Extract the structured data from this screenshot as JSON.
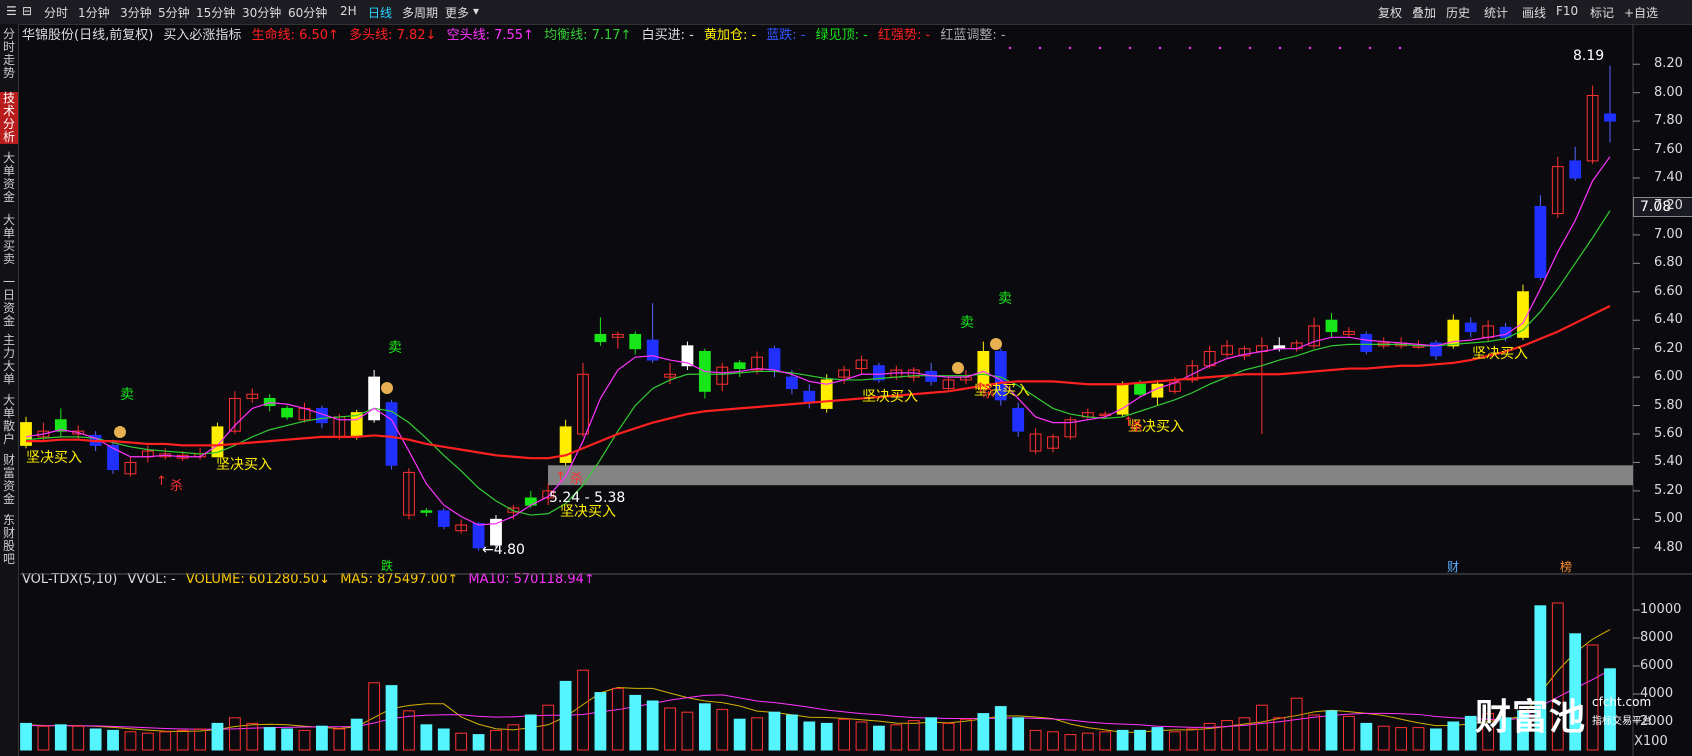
{
  "topbar": {
    "tabs": [
      "分时",
      "1分钟",
      "3分钟",
      "5分钟",
      "15分钟",
      "30分钟",
      "60分钟",
      "2H",
      "日线",
      "多周期",
      "更多"
    ],
    "active": "日线",
    "right_tabs": [
      "复权",
      "叠加",
      "历史",
      "统计",
      "画线",
      "F10",
      "标记",
      "+自选"
    ]
  },
  "sidebar": [
    "分时走势",
    "技术分析",
    "大单资金",
    "大单买卖",
    "一日资金",
    "主力大单",
    "大单散户",
    "财富资金",
    "东财股吧"
  ],
  "legend": {
    "stock": "华锦股份(日线,前复权)",
    "indicator": "买入必涨指标",
    "life_line": "生命线: 6.50↑",
    "bull_line": "多头线: 7.82↓",
    "bear_line": "空头线: 7.55↑",
    "balance_line": "均衡线: 7.17↑",
    "white_buy": "白买进: -",
    "yellow_add": "黄加仓: -",
    "blue_fall": "蓝跌: -",
    "green_top": "绿见顶: -",
    "red_strong": "红强势: -",
    "red_blue_adjust": "红蓝调整: -"
  },
  "price_axis": [
    "8.20",
    "8.00",
    "7.80",
    "7.60",
    "7.40",
    "7.20",
    "7.00",
    "6.80",
    "6.60",
    "6.40",
    "6.20",
    "6.00",
    "5.80",
    "5.60",
    "5.40",
    "5.20",
    "5.00",
    "4.80"
  ],
  "current_price": "7.08",
  "annotations": {
    "high": "8.19",
    "low": "4.80",
    "zone": "5.24 - 5.38",
    "firm_buy": "坚决买入",
    "sell": "卖",
    "kill": "杀",
    "fall": "跌",
    "fin": "财",
    "rank": "榜"
  },
  "volume_legend": {
    "name": "VOL-TDX(5,10)",
    "vvol": "VVOL: -",
    "volume": "VOLUME: 601280.50↓",
    "ma5": "MA5: 875497.00↑",
    "ma10": "MA10: 570118.94↑"
  },
  "volume_axis": [
    "10000",
    "8000",
    "6000",
    "4000",
    "2000"
  ],
  "volume_unit": "X100",
  "watermark": {
    "brand": "财富池",
    "site": "cfcht.com",
    "slogan": "指标交易平台"
  },
  "colors": {
    "up": "#ff3030",
    "down_blue": "#2030ff",
    "yellow": "#ffee00",
    "green": "#19e619",
    "white": "#ffffff",
    "life": "#ff2020",
    "magenta": "#ff33ff",
    "balance": "#33cc33",
    "vol_cyan": "#55f5ff"
  },
  "chart_data": {
    "type": "candlestick",
    "ylim": [
      4.7,
      8.3
    ],
    "candles": [
      [
        5.68,
        5.52,
        5.72,
        5.5,
        "yellow"
      ],
      [
        5.58,
        5.62,
        5.68,
        5.55,
        "up"
      ],
      [
        5.62,
        5.7,
        5.78,
        5.58,
        "green"
      ],
      [
        5.62,
        5.6,
        5.66,
        5.56,
        "up"
      ],
      [
        5.59,
        5.52,
        5.62,
        5.48,
        "blue"
      ],
      [
        5.52,
        5.35,
        5.56,
        5.32,
        "blue"
      ],
      [
        5.4,
        5.32,
        5.44,
        5.3,
        "up"
      ],
      [
        5.44,
        5.48,
        5.52,
        5.4,
        "up"
      ],
      [
        5.46,
        5.44,
        5.5,
        5.42,
        "up"
      ],
      [
        5.45,
        5.43,
        5.48,
        5.41,
        "up"
      ],
      [
        5.44,
        5.46,
        5.5,
        5.42,
        "up"
      ],
      [
        5.44,
        5.65,
        5.68,
        5.44,
        "yellow"
      ],
      [
        5.62,
        5.85,
        5.9,
        5.6,
        "up"
      ],
      [
        5.85,
        5.88,
        5.92,
        5.82,
        "up"
      ],
      [
        5.85,
        5.8,
        5.88,
        5.76,
        "green"
      ],
      [
        5.78,
        5.72,
        5.8,
        5.7,
        "green"
      ],
      [
        5.7,
        5.78,
        5.82,
        5.68,
        "up"
      ],
      [
        5.78,
        5.68,
        5.8,
        5.64,
        "blue"
      ],
      [
        5.72,
        5.58,
        5.74,
        5.56,
        "up"
      ],
      [
        5.58,
        5.75,
        5.77,
        5.56,
        "yellow"
      ],
      [
        5.7,
        6.0,
        6.05,
        5.68,
        "white"
      ],
      [
        5.82,
        5.38,
        5.84,
        5.35,
        "blue"
      ],
      [
        5.33,
        5.03,
        5.36,
        5.0,
        "up"
      ],
      [
        5.05,
        5.06,
        5.08,
        5.02,
        "green"
      ],
      [
        5.06,
        4.95,
        5.08,
        4.93,
        "blue"
      ],
      [
        4.96,
        4.92,
        5.0,
        4.9,
        "up"
      ],
      [
        4.97,
        4.8,
        4.98,
        4.78,
        "blue"
      ],
      [
        4.82,
        5.0,
        5.03,
        4.8,
        "white"
      ],
      [
        5.05,
        5.08,
        5.1,
        5.0,
        "up"
      ],
      [
        5.1,
        5.15,
        5.2,
        5.08,
        "green"
      ],
      [
        5.15,
        5.2,
        5.25,
        5.1,
        "up"
      ],
      [
        5.4,
        5.65,
        5.7,
        5.38,
        "yellow"
      ],
      [
        5.6,
        6.02,
        6.1,
        5.58,
        "up"
      ],
      [
        6.25,
        6.3,
        6.42,
        6.22,
        "green"
      ],
      [
        6.3,
        6.28,
        6.32,
        6.2,
        "up"
      ],
      [
        6.3,
        6.2,
        6.32,
        6.16,
        "green"
      ],
      [
        6.26,
        6.12,
        6.52,
        6.1,
        "blue"
      ],
      [
        6.02,
        6.0,
        6.1,
        5.95,
        "up"
      ],
      [
        6.22,
        6.08,
        6.25,
        6.05,
        "white"
      ],
      [
        6.18,
        5.9,
        6.2,
        5.85,
        "green"
      ],
      [
        5.95,
        6.07,
        6.1,
        5.9,
        "up"
      ],
      [
        6.06,
        6.1,
        6.12,
        6.0,
        "green"
      ],
      [
        6.05,
        6.14,
        6.18,
        6.02,
        "up"
      ],
      [
        6.2,
        6.05,
        6.22,
        6.0,
        "blue"
      ],
      [
        6.0,
        5.92,
        6.05,
        5.88,
        "blue"
      ],
      [
        5.9,
        5.82,
        5.95,
        5.78,
        "blue"
      ],
      [
        5.78,
        5.98,
        6.02,
        5.75,
        "yellow"
      ],
      [
        6.0,
        6.05,
        6.08,
        5.95,
        "up"
      ],
      [
        6.06,
        6.12,
        6.15,
        6.02,
        "up"
      ],
      [
        6.08,
        5.98,
        6.1,
        5.96,
        "blue"
      ],
      [
        6.0,
        6.05,
        6.08,
        5.98,
        "up"
      ],
      [
        6.0,
        6.05,
        6.07,
        5.97,
        "up"
      ],
      [
        6.04,
        5.97,
        6.1,
        5.94,
        "blue"
      ],
      [
        5.92,
        5.98,
        6.0,
        5.9,
        "up"
      ],
      [
        5.98,
        6.0,
        6.05,
        5.95,
        "up"
      ],
      [
        5.92,
        6.18,
        6.25,
        5.9,
        "yellow"
      ],
      [
        6.18,
        5.84,
        6.2,
        5.8,
        "blue"
      ],
      [
        5.78,
        5.62,
        5.82,
        5.58,
        "blue"
      ],
      [
        5.6,
        5.48,
        5.64,
        5.46,
        "up"
      ],
      [
        5.5,
        5.58,
        5.6,
        5.47,
        "up"
      ],
      [
        5.58,
        5.7,
        5.72,
        5.56,
        "up"
      ],
      [
        5.72,
        5.75,
        5.78,
        5.7,
        "up"
      ],
      [
        5.74,
        5.74,
        5.76,
        5.72,
        "up"
      ],
      [
        5.74,
        5.95,
        5.97,
        5.72,
        "yellow"
      ],
      [
        5.95,
        5.88,
        5.98,
        5.86,
        "green"
      ],
      [
        5.86,
        5.95,
        5.98,
        5.8,
        "yellow"
      ],
      [
        5.9,
        5.96,
        6.0,
        5.88,
        "up"
      ],
      [
        5.98,
        6.08,
        6.12,
        5.96,
        "up"
      ],
      [
        6.08,
        6.18,
        6.22,
        6.06,
        "up"
      ],
      [
        6.16,
        6.22,
        6.26,
        6.14,
        "up"
      ],
      [
        6.2,
        6.15,
        6.22,
        6.12,
        "up"
      ],
      [
        6.18,
        6.22,
        6.28,
        5.6,
        "up"
      ],
      [
        6.2,
        6.22,
        6.28,
        6.18,
        "white"
      ],
      [
        6.24,
        6.2,
        6.26,
        6.18,
        "up"
      ],
      [
        6.22,
        6.36,
        6.42,
        6.2,
        "up"
      ],
      [
        6.4,
        6.32,
        6.45,
        6.28,
        "green"
      ],
      [
        6.3,
        6.32,
        6.35,
        6.28,
        "up"
      ],
      [
        6.3,
        6.18,
        6.32,
        6.16,
        "blue"
      ],
      [
        6.22,
        6.24,
        6.28,
        6.2,
        "up"
      ],
      [
        6.24,
        6.22,
        6.28,
        6.2,
        "up"
      ],
      [
        6.22,
        6.22,
        6.26,
        6.2,
        "up"
      ],
      [
        6.24,
        6.15,
        6.26,
        6.12,
        "blue"
      ],
      [
        6.22,
        6.4,
        6.44,
        6.2,
        "yellow"
      ],
      [
        6.38,
        6.32,
        6.42,
        6.28,
        "blue"
      ],
      [
        6.28,
        6.36,
        6.4,
        6.25,
        "up"
      ],
      [
        6.35,
        6.28,
        6.38,
        6.25,
        "blue"
      ],
      [
        6.28,
        6.6,
        6.65,
        6.26,
        "yellow"
      ],
      [
        6.7,
        7.2,
        7.28,
        6.68,
        "blue"
      ],
      [
        7.15,
        7.48,
        7.55,
        7.12,
        "up"
      ],
      [
        7.52,
        7.4,
        7.62,
        7.38,
        "blue"
      ],
      [
        7.52,
        7.98,
        8.05,
        7.5,
        "up"
      ],
      [
        7.85,
        7.8,
        8.19,
        7.65,
        "blue"
      ]
    ],
    "life_line": [
      5.55,
      5.55,
      5.56,
      5.56,
      5.55,
      5.55,
      5.54,
      5.53,
      5.53,
      5.52,
      5.52,
      5.52,
      5.53,
      5.54,
      5.55,
      5.56,
      5.57,
      5.58,
      5.58,
      5.58,
      5.59,
      5.58,
      5.56,
      5.53,
      5.51,
      5.49,
      5.47,
      5.45,
      5.44,
      5.43,
      5.43,
      5.45,
      5.5,
      5.55,
      5.6,
      5.64,
      5.68,
      5.71,
      5.74,
      5.76,
      5.77,
      5.78,
      5.79,
      5.8,
      5.81,
      5.82,
      5.83,
      5.84,
      5.85,
      5.86,
      5.87,
      5.88,
      5.89,
      5.9,
      5.92,
      5.94,
      5.96,
      5.97,
      5.97,
      5.97,
      5.96,
      5.95,
      5.95,
      5.95,
      5.96,
      5.97,
      5.98,
      5.99,
      6.0,
      6.01,
      6.02,
      6.02,
      6.02,
      6.03,
      6.04,
      6.05,
      6.06,
      6.06,
      6.07,
      6.08,
      6.08,
      6.09,
      6.1,
      6.12,
      6.15,
      6.18,
      6.22,
      6.27,
      6.32,
      6.38,
      6.44,
      6.5
    ],
    "magenta_line": [
      5.58,
      5.6,
      5.63,
      5.61,
      5.57,
      5.5,
      5.44,
      5.44,
      5.45,
      5.44,
      5.44,
      5.52,
      5.66,
      5.78,
      5.82,
      5.81,
      5.78,
      5.74,
      5.7,
      5.7,
      5.78,
      5.7,
      5.48,
      5.25,
      5.1,
      5.02,
      4.96,
      4.97,
      5.02,
      5.1,
      5.16,
      5.3,
      5.55,
      5.85,
      6.05,
      6.14,
      6.15,
      6.12,
      6.1,
      6.04,
      6.03,
      6.04,
      6.06,
      6.05,
      6.02,
      5.97,
      5.95,
      5.98,
      6.02,
      6.02,
      6.03,
      6.03,
      6.01,
      6.0,
      6.0,
      6.04,
      5.98,
      5.85,
      5.72,
      5.68,
      5.68,
      5.7,
      5.72,
      5.78,
      5.86,
      5.92,
      5.96,
      6.02,
      6.08,
      6.13,
      6.16,
      6.18,
      6.2,
      6.2,
      6.25,
      6.28,
      6.28,
      6.26,
      6.25,
      6.24,
      6.23,
      6.22,
      6.25,
      6.26,
      6.28,
      6.3,
      6.38,
      6.62,
      6.88,
      7.1,
      7.38,
      7.55
    ],
    "green_line": [
      5.56,
      5.57,
      5.58,
      5.58,
      5.57,
      5.54,
      5.51,
      5.49,
      5.48,
      5.47,
      5.46,
      5.47,
      5.52,
      5.58,
      5.63,
      5.66,
      5.69,
      5.71,
      5.72,
      5.73,
      5.78,
      5.76,
      5.68,
      5.57,
      5.45,
      5.34,
      5.22,
      5.13,
      5.06,
      5.03,
      5.04,
      5.11,
      5.24,
      5.42,
      5.62,
      5.8,
      5.92,
      5.98,
      6.02,
      6.02,
      6.02,
      6.03,
      6.04,
      6.04,
      6.03,
      6.01,
      5.99,
      5.98,
      5.98,
      5.99,
      6.0,
      6.01,
      6.01,
      6.01,
      6.01,
      6.02,
      6.0,
      5.94,
      5.86,
      5.78,
      5.74,
      5.72,
      5.71,
      5.72,
      5.76,
      5.8,
      5.84,
      5.89,
      5.95,
      6.0,
      6.05,
      6.08,
      6.12,
      6.15,
      6.19,
      6.22,
      6.23,
      6.23,
      6.23,
      6.23,
      6.22,
      6.22,
      6.23,
      6.24,
      6.25,
      6.27,
      6.33,
      6.46,
      6.62,
      6.8,
      6.98,
      7.17
    ],
    "zone": [
      5.24,
      5.38
    ],
    "volumes": [
      1900,
      1700,
      1800,
      1700,
      1500,
      1400,
      1300,
      1200,
      1300,
      1400,
      1500,
      1900,
      2300,
      1900,
      1600,
      1500,
      1400,
      1700,
      1500,
      2200,
      4800,
      4600,
      2800,
      1800,
      1500,
      1200,
      1100,
      1400,
      1800,
      2500,
      3200,
      4900,
      5700,
      4100,
      4400,
      3900,
      3500,
      3000,
      2700,
      3300,
      2900,
      2200,
      2300,
      2700,
      2500,
      2000,
      1900,
      2200,
      2000,
      1700,
      1800,
      2100,
      2300,
      1900,
      2200,
      2600,
      3100,
      2300,
      1400,
      1300,
      1100,
      1200,
      1300,
      1400,
      1400,
      1600,
      1300,
      1500,
      1900,
      2100,
      2300,
      3200,
      2300,
      3700,
      2500,
      2800,
      2400,
      1900,
      1700,
      1600,
      1600,
      1500,
      2000,
      2400,
      2600,
      2300,
      2800,
      10300,
      10500,
      8300,
      7500,
      5800
    ],
    "ma5": [
      1800,
      1750,
      1740,
      1730,
      1700,
      1620,
      1520,
      1420,
      1340,
      1320,
      1360,
      1460,
      1680,
      1800,
      1840,
      1800,
      1700,
      1620,
      1540,
      1660,
      2320,
      2960,
      3180,
      3300,
      3300,
      2360,
      1840,
      1520,
      1440,
      1600,
      1800,
      2380,
      3240,
      4080,
      4460,
      4400,
      4400,
      4060,
      3740,
      3500,
      3380,
      3140,
      2780,
      2680,
      2520,
      2340,
      2320,
      2260,
      2160,
      2060,
      1920,
      1900,
      1980,
      1940,
      2060,
      2220,
      2420,
      2440,
      2360,
      2240,
      1860,
      1600,
      1440,
      1260,
      1280,
      1380,
      1440,
      1440,
      1540,
      1680,
      1860,
      2000,
      2260,
      2460,
      2720,
      2840,
      2740,
      2620,
      2460,
      2200,
      1940,
      1740,
      1760,
      1860,
      2040,
      2200,
      2420,
      4080,
      5660,
      6960,
      7920,
      8600
    ],
    "ma10": [
      1750,
      1740,
      1735,
      1730,
      1720,
      1690,
      1640,
      1590,
      1540,
      1500,
      1480,
      1480,
      1510,
      1560,
      1600,
      1620,
      1640,
      1650,
      1660,
      1680,
      1930,
      2240,
      2400,
      2480,
      2520,
      2520,
      2400,
      2350,
      2370,
      2440,
      2480,
      2480,
      2540,
      2720,
      2880,
      3100,
      3320,
      3560,
      3740,
      3900,
      3940,
      3720,
      3500,
      3380,
      3230,
      3050,
      2860,
      2720,
      2600,
      2520,
      2400,
      2310,
      2290,
      2250,
      2250,
      2250,
      2270,
      2300,
      2260,
      2210,
      2140,
      2000,
      1900,
      1850,
      1800,
      1700,
      1660,
      1620,
      1620,
      1680,
      1760,
      1890,
      2020,
      2180,
      2340,
      2460,
      2560,
      2620,
      2620,
      2590,
      2540,
      2390,
      2300,
      2240,
      2200,
      2160,
      2280,
      3130,
      3770,
      4420,
      5030,
      5700
    ],
    "vol_ylim": [
      0,
      11000
    ]
  }
}
